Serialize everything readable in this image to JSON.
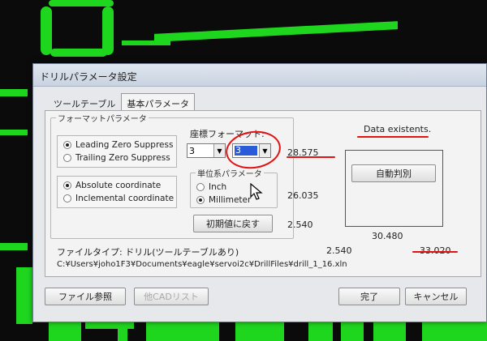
{
  "dialog": {
    "title": "ドリルパラメータ設定",
    "tabs": [
      {
        "label": "ツールテーブル",
        "active": false
      },
      {
        "label": "基本パラメータ",
        "active": true
      }
    ]
  },
  "format_group": {
    "title": "フォーマットパラメータ",
    "zero_suppress": [
      {
        "label": "Leading Zero Suppress",
        "selected": true
      },
      {
        "label": "Trailing Zero Suppress",
        "selected": false
      }
    ],
    "coordinate_mode": [
      {
        "label": "Absolute coordinate",
        "selected": true
      },
      {
        "label": "Inclemental coordinate",
        "selected": false
      }
    ],
    "coord_format": {
      "title": "座標フォーマット:",
      "integer_digits": "3",
      "decimal_digits": "3"
    },
    "unit_group": {
      "title": "単位系パラメータ",
      "options": [
        {
          "label": "Inch",
          "selected": false
        },
        {
          "label": "Millimeter",
          "selected": true
        }
      ]
    },
    "reset_button": "初期値に戻す"
  },
  "status": {
    "data_status": "Data existents.",
    "auto_detect_button": "自動判別",
    "y_values": [
      "28.575",
      "26.035",
      "2.540"
    ],
    "x_values": [
      "2.540",
      "30.480",
      "33.020"
    ]
  },
  "file_info": {
    "type_label": "ファイルタイプ: ドリル(ツールテーブルあり)",
    "path": "C:¥Users¥joho1F3¥Documents¥eagle¥servoi2c¥DrillFiles¥drill_1_16.xln"
  },
  "footer": {
    "browse_button": "ファイル参照",
    "other_cad_button": "他CADリスト",
    "ok_button": "完了",
    "cancel_button": "キャンセル"
  },
  "colors": {
    "annotation": "#e01212",
    "pcb_trace": "#1fd61f",
    "selection": "#2a5bd8"
  }
}
